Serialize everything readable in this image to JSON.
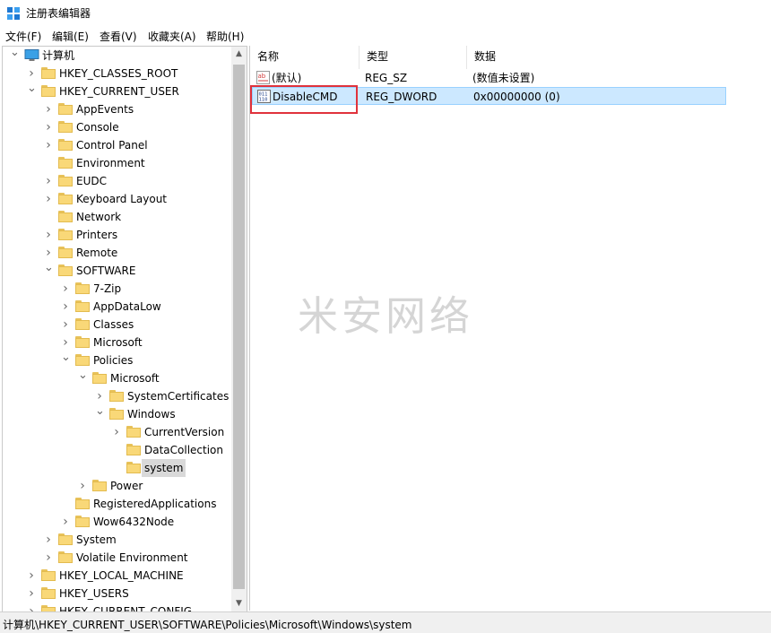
{
  "window": {
    "title": "注册表编辑器"
  },
  "menu": [
    "文件(F)",
    "编辑(E)",
    "查看(V)",
    "收藏夹(A)",
    "帮助(H)"
  ],
  "tree": [
    {
      "label": "计算机",
      "depth": 0,
      "caret": "v",
      "icon": "computer-icon"
    },
    {
      "label": "HKEY_CLASSES_ROOT",
      "depth": 1,
      "caret": ">"
    },
    {
      "label": "HKEY_CURRENT_USER",
      "depth": 1,
      "caret": "v"
    },
    {
      "label": "AppEvents",
      "depth": 2,
      "caret": ">"
    },
    {
      "label": "Console",
      "depth": 2,
      "caret": ">"
    },
    {
      "label": "Control Panel",
      "depth": 2,
      "caret": ">"
    },
    {
      "label": "Environment",
      "depth": 2,
      "caret": ""
    },
    {
      "label": "EUDC",
      "depth": 2,
      "caret": ">"
    },
    {
      "label": "Keyboard Layout",
      "depth": 2,
      "caret": ">"
    },
    {
      "label": "Network",
      "depth": 2,
      "caret": ""
    },
    {
      "label": "Printers",
      "depth": 2,
      "caret": ">"
    },
    {
      "label": "Remote",
      "depth": 2,
      "caret": ">"
    },
    {
      "label": "SOFTWARE",
      "depth": 2,
      "caret": "v"
    },
    {
      "label": "7-Zip",
      "depth": 3,
      "caret": ">"
    },
    {
      "label": "AppDataLow",
      "depth": 3,
      "caret": ">"
    },
    {
      "label": "Classes",
      "depth": 3,
      "caret": ">"
    },
    {
      "label": "Microsoft",
      "depth": 3,
      "caret": ">"
    },
    {
      "label": "Policies",
      "depth": 3,
      "caret": "v"
    },
    {
      "label": "Microsoft",
      "depth": 4,
      "caret": "v"
    },
    {
      "label": "SystemCertificates",
      "depth": 5,
      "caret": ">"
    },
    {
      "label": "Windows",
      "depth": 5,
      "caret": "v"
    },
    {
      "label": "CurrentVersion",
      "depth": 6,
      "caret": ">"
    },
    {
      "label": "DataCollection",
      "depth": 6,
      "caret": ""
    },
    {
      "label": "system",
      "depth": 6,
      "caret": "",
      "selected": true
    },
    {
      "label": "Power",
      "depth": 4,
      "caret": ">"
    },
    {
      "label": "RegisteredApplications",
      "depth": 3,
      "caret": ""
    },
    {
      "label": "Wow6432Node",
      "depth": 3,
      "caret": ">"
    },
    {
      "label": "System",
      "depth": 2,
      "caret": ">"
    },
    {
      "label": "Volatile Environment",
      "depth": 2,
      "caret": ">"
    },
    {
      "label": "HKEY_LOCAL_MACHINE",
      "depth": 1,
      "caret": ">"
    },
    {
      "label": "HKEY_USERS",
      "depth": 1,
      "caret": ">"
    },
    {
      "label": "HKEY_CURRENT_CONFIG",
      "depth": 1,
      "caret": ">"
    }
  ],
  "list": {
    "headers": {
      "name": "名称",
      "type": "类型",
      "data": "数据"
    },
    "rows": [
      {
        "name": "(默认)",
        "type": "REG_SZ",
        "data": "(数值未设置)",
        "icon": "string-value-icon",
        "selected": false
      },
      {
        "name": "DisableCMD",
        "type": "REG_DWORD",
        "data": "0x00000000 (0)",
        "icon": "dword-value-icon",
        "selected": true
      }
    ]
  },
  "watermark": "米安网络",
  "status": {
    "path": "计算机\\HKEY_CURRENT_USER\\SOFTWARE\\Policies\\Microsoft\\Windows\\system"
  },
  "colors": {
    "selection_bg": "#cce8ff",
    "highlight_border": "#e0323c",
    "folder": "#f9d878"
  }
}
